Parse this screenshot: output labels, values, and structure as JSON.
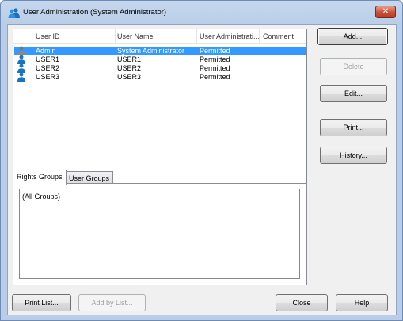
{
  "window": {
    "title": "User Administration (System Administrator)",
    "close_symbol": "✕"
  },
  "user_list": {
    "columns": [
      "User ID",
      "User Name",
      "User Administrati...",
      "Comment"
    ],
    "rows": [
      {
        "user_id": "Admin",
        "user_name": "System Administrator",
        "user_admin": "Permitted",
        "comment": "",
        "icon": "admin-user-icon",
        "selected": true
      },
      {
        "user_id": "USER1",
        "user_name": "USER1",
        "user_admin": "Permitted",
        "comment": "",
        "icon": "user-icon",
        "selected": false
      },
      {
        "user_id": "USER2",
        "user_name": "USER2",
        "user_admin": "Permitted",
        "comment": "",
        "icon": "user-icon",
        "selected": false
      },
      {
        "user_id": "USER3",
        "user_name": "USER3",
        "user_admin": "Permitted",
        "comment": "",
        "icon": "user-icon",
        "selected": false
      }
    ],
    "selection_color": "#3399ff"
  },
  "side_buttons": {
    "add": "Add...",
    "delete": "Delete",
    "edit": "Edit...",
    "print": "Print...",
    "history": "History..."
  },
  "tabs": {
    "rights_groups": "Rights Groups",
    "user_groups": "User Groups",
    "active": "rights_groups"
  },
  "groups_list": {
    "items": [
      "(All Groups)"
    ]
  },
  "bottom_buttons": {
    "print_list": "Print List...",
    "add_by_list": "Add by List...",
    "close": "Close",
    "help": "Help"
  }
}
